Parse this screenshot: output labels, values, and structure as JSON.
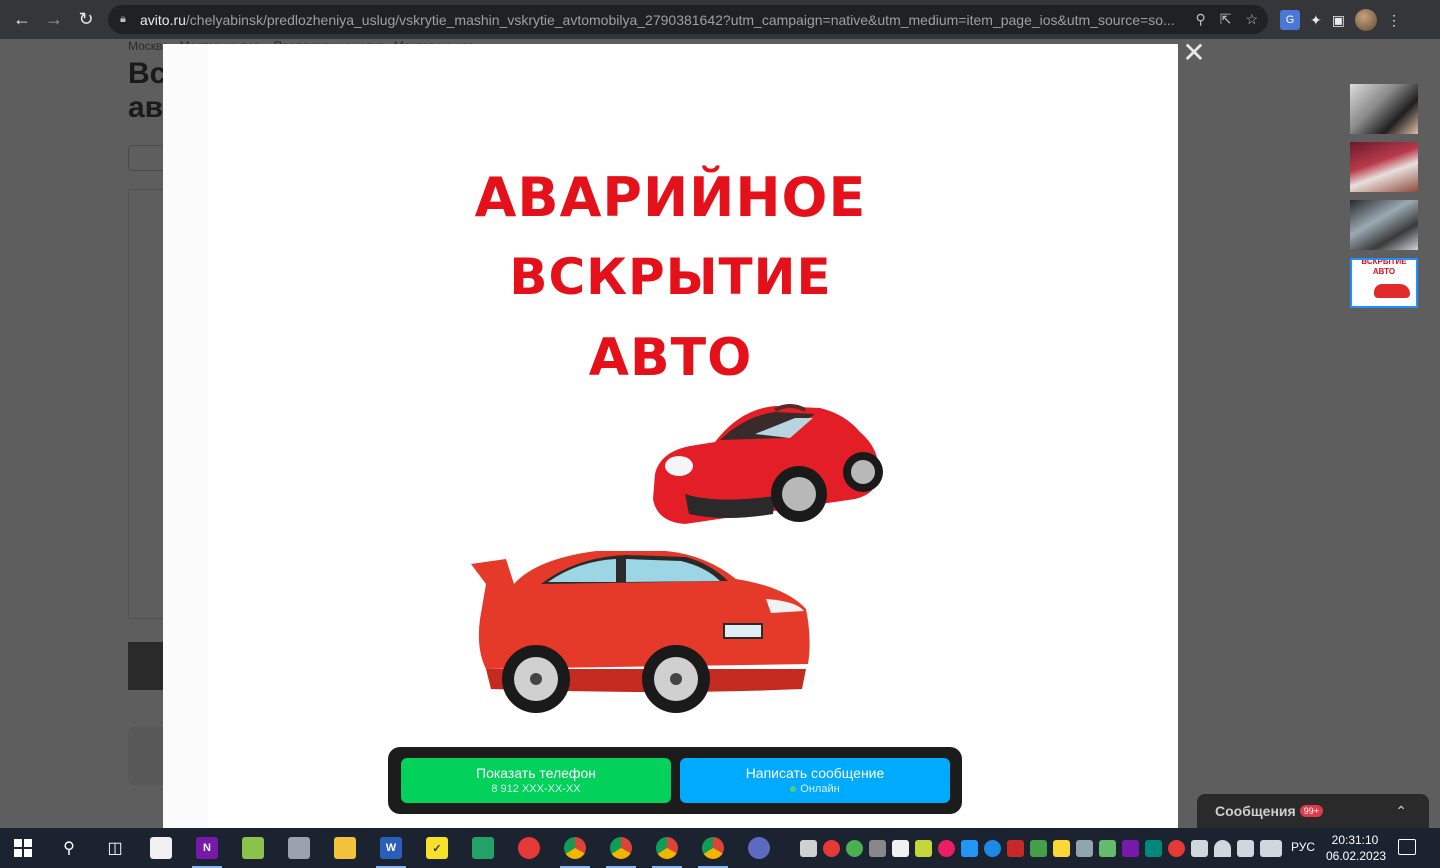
{
  "browser": {
    "url_host": "avito.ru",
    "url_path": "/chelyabinsk/predlozheniya_uslug/vskrytie_mashin_vskrytie_avtomobilya_2790381642?utm_campaign=native&utm_medium=item_page_ios&utm_source=so..."
  },
  "background_page": {
    "breadcrumbs": "Москва · Мастер на все...  Предложение услуг · Мастер на час",
    "title": "Вс ав"
  },
  "poster": {
    "line1": "АВАРИЙНОЕ",
    "line2": "ВСКРЫТИЕ",
    "line3": "АВТО",
    "thumb_text1": "ВСКРЫТИЕ",
    "thumb_text2": "АВТО"
  },
  "contact": {
    "phone_label": "Показать телефон",
    "phone_number": "8 912 XXX-XX-XX",
    "message_label": "Написать сообщение",
    "status": "Онлайн"
  },
  "messages_widget": {
    "label": "Сообщения",
    "badge": "99+"
  },
  "taskbar": {
    "language": "РУС",
    "time": "20:31:10",
    "date": "06.02.2023"
  },
  "colors": {
    "poster_red": "#e4101a",
    "phone_green": "#02d15c",
    "message_blue": "#00aaff"
  }
}
